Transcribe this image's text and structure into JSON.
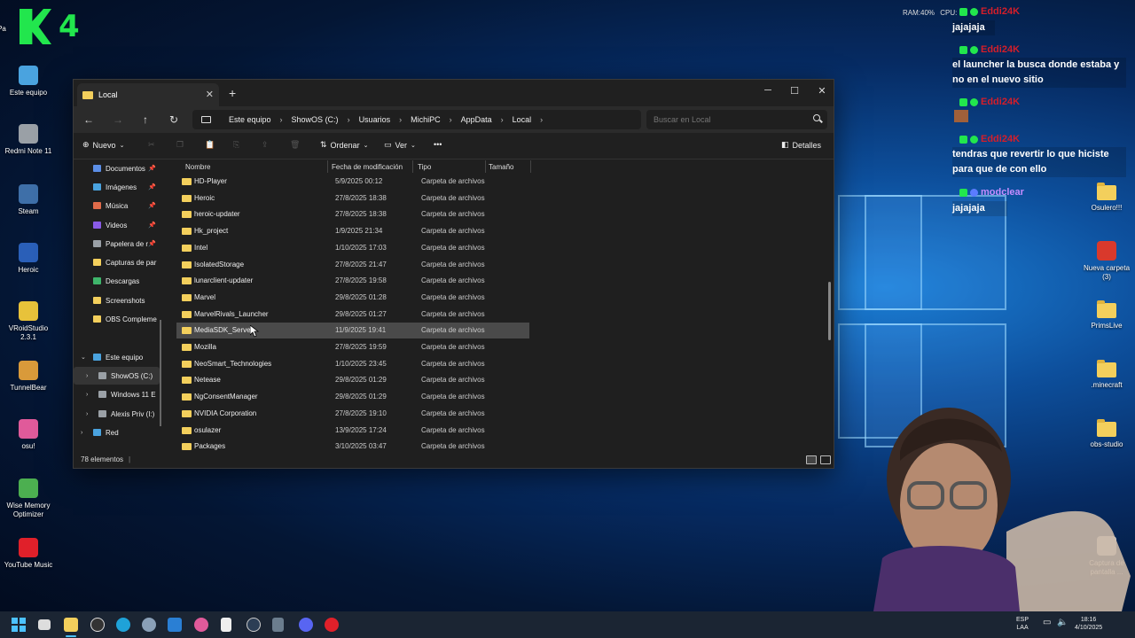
{
  "overlay": {
    "logo_text": "4"
  },
  "desktop_left": [
    {
      "label": "Pa",
      "name": "partial-icon"
    },
    {
      "label": "Este equipo",
      "name": "este-equipo"
    },
    {
      "label": "Redmi Note 11",
      "name": "redmi-note-11"
    },
    {
      "label": "Steam",
      "name": "steam"
    },
    {
      "label": "Heroic",
      "name": "heroic"
    },
    {
      "label": "VRoidStudio 2.3.1",
      "name": "vroidstudio"
    },
    {
      "label": "TunnelBear",
      "name": "tunnelbear"
    },
    {
      "label": "osu!",
      "name": "osu"
    },
    {
      "label": "Wise Memory Optimizer",
      "name": "wise-memory-optimizer"
    },
    {
      "label": "YouTube Music",
      "name": "youtube-music"
    }
  ],
  "desktop_right": [
    {
      "label": "Osulero!!!",
      "name": "osulero"
    },
    {
      "label": "Nueva carpeta (3)",
      "name": "nueva-carpeta-3"
    },
    {
      "label": "PrimsLive",
      "name": "primslive"
    },
    {
      "label": ".minecraft",
      "name": "minecraft"
    },
    {
      "label": "obs-studio",
      "name": "obs-studio"
    },
    {
      "label": "Captura de pantalla ...",
      "name": "captura-de-pantalla"
    }
  ],
  "sysinfo": {
    "ram": "RAM:40%",
    "cpu": "CPU:"
  },
  "chat": [
    {
      "user": "Eddi24K",
      "msg": "jajajaja"
    },
    {
      "user": "Eddi24K",
      "msg": "el launcher la busca donde estaba y no en el nuevo sitio"
    },
    {
      "user": "Eddi24K",
      "msg": ""
    },
    {
      "user": "Eddi24K",
      "msg": "tendras que revertir lo que hiciste para que de con ello"
    },
    {
      "user": "modclear",
      "msg": "jajajaja"
    }
  ],
  "explorer": {
    "tab_title": "Local",
    "breadcrumbs": [
      "Este equipo",
      "ShowOS (C:)",
      "Usuarios",
      "MichiPC",
      "AppData",
      "Local"
    ],
    "search_placeholder": "Buscar en Local",
    "toolbar": {
      "new": "Nuevo",
      "sort": "Ordenar",
      "view": "Ver",
      "details": "Detalles"
    },
    "sidebar": [
      {
        "label": "Documentos",
        "pinned": true,
        "color": "#5b8ee6"
      },
      {
        "label": "Imágenes",
        "pinned": true,
        "color": "#4aa3df"
      },
      {
        "label": "Música",
        "pinned": true,
        "color": "#e06b4a"
      },
      {
        "label": "Videos",
        "pinned": true,
        "color": "#8a5be6"
      },
      {
        "label": "Papelera de r",
        "pinned": true,
        "color": "#9aa0a6"
      },
      {
        "label": "Capturas de par",
        "pinned": false,
        "color": "#f3cf5c"
      },
      {
        "label": "Descargas",
        "pinned": false,
        "color": "#3fb56b"
      },
      {
        "label": "Screenshots",
        "pinned": false,
        "color": "#f3cf5c"
      },
      {
        "label": "OBS Compleme",
        "pinned": false,
        "color": "#f3cf5c"
      },
      {
        "label": "Este equipo",
        "pinned": false,
        "color": "#4aa3df"
      },
      {
        "label": "ShowOS (C:)",
        "pinned": false,
        "color": "#9aa0a6"
      },
      {
        "label": "Windows 11 E",
        "pinned": false,
        "color": "#9aa0a6"
      },
      {
        "label": "Alexis Priv (I:)",
        "pinned": false,
        "color": "#9aa0a6"
      },
      {
        "label": "Red",
        "pinned": false,
        "color": "#4aa3df"
      }
    ],
    "columns": {
      "name": "Nombre",
      "modified": "Fecha de modificación",
      "type": "Tipo",
      "size": "Tamaño"
    },
    "rows": [
      {
        "name": "HD-Player",
        "date": "5/9/2025 00:12",
        "type": "Carpeta de archivos"
      },
      {
        "name": "Heroic",
        "date": "27/8/2025 18:38",
        "type": "Carpeta de archivos"
      },
      {
        "name": "heroic-updater",
        "date": "27/8/2025 18:38",
        "type": "Carpeta de archivos"
      },
      {
        "name": "Hk_project",
        "date": "1/9/2025 21:34",
        "type": "Carpeta de archivos"
      },
      {
        "name": "Intel",
        "date": "1/10/2025 17:03",
        "type": "Carpeta de archivos"
      },
      {
        "name": "IsolatedStorage",
        "date": "27/8/2025 21:47",
        "type": "Carpeta de archivos"
      },
      {
        "name": "lunarclient-updater",
        "date": "27/8/2025 19:58",
        "type": "Carpeta de archivos"
      },
      {
        "name": "Marvel",
        "date": "29/8/2025 01:28",
        "type": "Carpeta de archivos"
      },
      {
        "name": "MarvelRivals_Launcher",
        "date": "29/8/2025 01:27",
        "type": "Carpeta de archivos"
      },
      {
        "name": "MediaSDK_Server",
        "date": "11/9/2025 19:41",
        "type": "Carpeta de archivos"
      },
      {
        "name": "Mozilla",
        "date": "27/8/2025 19:59",
        "type": "Carpeta de archivos"
      },
      {
        "name": "NeoSmart_Technologies",
        "date": "1/10/2025 23:45",
        "type": "Carpeta de archivos"
      },
      {
        "name": "Netease",
        "date": "29/8/2025 01:29",
        "type": "Carpeta de archivos"
      },
      {
        "name": "NgConsentManager",
        "date": "29/8/2025 01:29",
        "type": "Carpeta de archivos"
      },
      {
        "name": "NVIDIA Corporation",
        "date": "27/8/2025 19:10",
        "type": "Carpeta de archivos"
      },
      {
        "name": "osulazer",
        "date": "13/9/2025 17:24",
        "type": "Carpeta de archivos"
      },
      {
        "name": "Packages",
        "date": "3/10/2025 03:47",
        "type": "Carpeta de archivos"
      }
    ],
    "selected_index": 9,
    "status": "78 elementos"
  },
  "taskbar": {
    "lang": "ESP",
    "lang2": "LAA",
    "time": "18:16",
    "date": "4/10/2025"
  }
}
